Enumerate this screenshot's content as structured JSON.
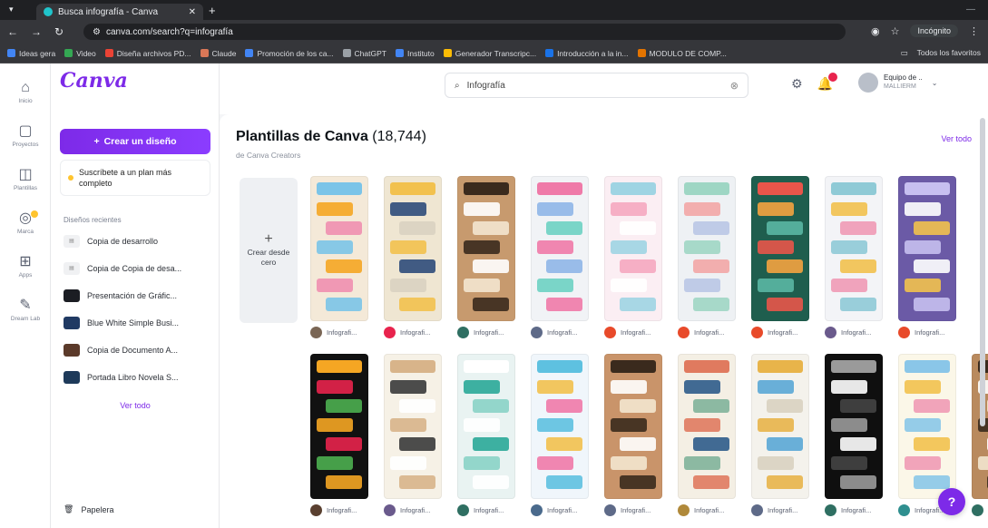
{
  "browser": {
    "tab_title": "Busca infografía - Canva",
    "url": "canva.com/search?q=infografía",
    "profile_label": "Incógnito",
    "bookmarks": [
      {
        "label": "Ideas gera",
        "color": "#4285f4"
      },
      {
        "label": "Video",
        "color": "#34a853"
      },
      {
        "label": "Diseña archivos PD...",
        "color": "#ea4335"
      },
      {
        "label": "Claude",
        "color": "#d97757"
      },
      {
        "label": "Promoción de los ca...",
        "color": "#4285f4"
      },
      {
        "label": "ChatGPT",
        "color": "#9aa0a6"
      },
      {
        "label": "Instituto",
        "color": "#4285f4"
      },
      {
        "label": "Generador Transcripc...",
        "color": "#fbbc05"
      },
      {
        "label": "Introducción a la in...",
        "color": "#1a73e8"
      },
      {
        "label": "MODULO DE COMP...",
        "color": "#e37400"
      }
    ],
    "bookmarks_right": "Todos los favoritos"
  },
  "rail": [
    {
      "icon": "home-icon",
      "glyph": "⌂",
      "label": "Inicio"
    },
    {
      "icon": "folder-icon",
      "glyph": "▢",
      "label": "Proyectos"
    },
    {
      "icon": "template-icon",
      "glyph": "◫",
      "label": "Plantillas"
    },
    {
      "icon": "brand-icon",
      "glyph": "◎",
      "label": "Marca"
    },
    {
      "icon": "apps-icon",
      "glyph": "⊞",
      "label": "Apps"
    },
    {
      "icon": "dream-lab-icon",
      "glyph": "✎",
      "label": "Dream Lab"
    }
  ],
  "panel": {
    "logo": "Canva",
    "create_label": "Crear un diseño",
    "upsell_text": "Suscríbete a un plan más completo",
    "recent_title": "Diseños recientes",
    "recent": [
      {
        "label": "Copia de desarrollo",
        "thumb": "text",
        "color": "#f0f1f3"
      },
      {
        "label": "Copia de Copia de desa...",
        "thumb": "text",
        "color": "#f0f1f3"
      },
      {
        "label": "Presentación de Gráfic...",
        "thumb": "img",
        "color": "#1b1d23"
      },
      {
        "label": "Blue White Simple Busi...",
        "thumb": "img",
        "color": "#203a63"
      },
      {
        "label": "Copia de Documento A...",
        "thumb": "img",
        "color": "#5b3a2a"
      },
      {
        "label": "Portada Libro Novela S...",
        "thumb": "img",
        "color": "#1e3a5a"
      }
    ],
    "see_all": "Ver todo",
    "trash_label": "Papelera"
  },
  "topbar": {
    "search_value": "Infografía",
    "team_name": "Equipo de ..",
    "team_sub": "MALLIERM"
  },
  "section": {
    "title": "Plantillas de Canva",
    "count": "(18,744)",
    "subtitle": "de Canva Creators",
    "see_all": "Ver todo",
    "create_blank": "Crear desde cero"
  },
  "templates_row1": [
    {
      "bg": "#f4e9d8",
      "accent1": "#f5a623",
      "accent2": "#7bc4e8",
      "accent3": "#ef8fb0",
      "author": "Infografi...",
      "ava": "#7a6655"
    },
    {
      "bg": "#efe6d2",
      "accent1": "#2e4b7a",
      "accent2": "#f2c14e",
      "accent3": "#d9d2c1",
      "author": "Infografi...",
      "ava": "#e8234d"
    },
    {
      "bg": "#c79a6e",
      "accent1": "#ffffff",
      "accent2": "#3a2a1d",
      "accent3": "#f3e6cf",
      "author": "Infografi...",
      "ava": "#2f6f62"
    },
    {
      "bg": "#f1f3f6",
      "accent1": "#8fb6e8",
      "accent2": "#ef7aa8",
      "accent3": "#6dd2c3",
      "author": "Infografi...",
      "ava": "#5e6a88"
    },
    {
      "bg": "#fbeef3",
      "accent1": "#f5a7c0",
      "accent2": "#9fd4e3",
      "accent3": "#ffffff",
      "author": "Infografi...",
      "ava": "#e84a2a"
    },
    {
      "bg": "#eef1f4",
      "accent1": "#f2a6a6",
      "accent2": "#9ed6c4",
      "accent3": "#b9c7e6",
      "author": "Infografi...",
      "ava": "#e84a2a"
    },
    {
      "bg": "#1f5e4e",
      "accent1": "#f4a340",
      "accent2": "#e8554a",
      "accent3": "#5ab7a4",
      "author": "Infografi...",
      "ava": "#e84a2a"
    },
    {
      "bg": "#f3f4f7",
      "accent1": "#f2c14e",
      "accent2": "#8fcad6",
      "accent3": "#ef9ab5",
      "author": "Infografi...",
      "ava": "#6a5a8c"
    },
    {
      "bg": "#6b5aa6",
      "accent1": "#ffffff",
      "accent2": "#c7bff0",
      "accent3": "#f2c14e",
      "author": "Infografi...",
      "ava": "#e84a2a"
    }
  ],
  "templates_row2": [
    {
      "bg": "#111111",
      "accent1": "#e8234d",
      "accent2": "#f5a623",
      "accent3": "#4caf50",
      "author": "Infografi...",
      "ava": "#5a4030"
    },
    {
      "bg": "#f6f1e6",
      "accent1": "#3a3a3a",
      "accent2": "#d8b48a",
      "accent3": "#ffffff",
      "author": "Infografi...",
      "ava": "#6a5a8c"
    },
    {
      "bg": "#e9f3f2",
      "accent1": "#2aa898",
      "accent2": "#ffffff",
      "accent3": "#8ad3c7",
      "author": "Infografi...",
      "ava": "#2f6f62"
    },
    {
      "bg": "#f0f6fb",
      "accent1": "#f2c14e",
      "accent2": "#5ec1e0",
      "accent3": "#ef7aa8",
      "author": "Infografi...",
      "ava": "#4a6a8c"
    },
    {
      "bg": "#c9946a",
      "accent1": "#ffffff",
      "accent2": "#3a2a1d",
      "accent3": "#f3e6cf",
      "author": "Infografi...",
      "ava": "#5e6a88"
    },
    {
      "bg": "#f4efe4",
      "accent1": "#2e5b8a",
      "accent2": "#e07a5f",
      "accent3": "#81b29a",
      "author": "Infografi...",
      "ava": "#b0893a"
    },
    {
      "bg": "#f4f2ec",
      "accent1": "#5aa7d6",
      "accent2": "#e8b44a",
      "accent3": "#d9d2c1",
      "author": "Infografi...",
      "ava": "#5e6a88"
    },
    {
      "bg": "#0f0f0f",
      "accent1": "#ffffff",
      "accent2": "#9a9a9a",
      "accent3": "#444444",
      "author": "Infografi...",
      "ava": "#2f6f62"
    },
    {
      "bg": "#fbf7e8",
      "accent1": "#f2c14e",
      "accent2": "#8ac6e8",
      "accent3": "#ef9ab5",
      "author": "Infografi...",
      "ava": "#2f8f8f"
    },
    {
      "bg": "#b98a5e",
      "accent1": "#ffffff",
      "accent2": "#3a2a1d",
      "accent3": "#f3e6cf",
      "author": "Infografi...",
      "ava": "#2f6f62"
    }
  ],
  "colors": {
    "brand_purple": "#7d2ae8",
    "badge_yellow": "#ffc42e",
    "notification_red": "#e8234d"
  }
}
